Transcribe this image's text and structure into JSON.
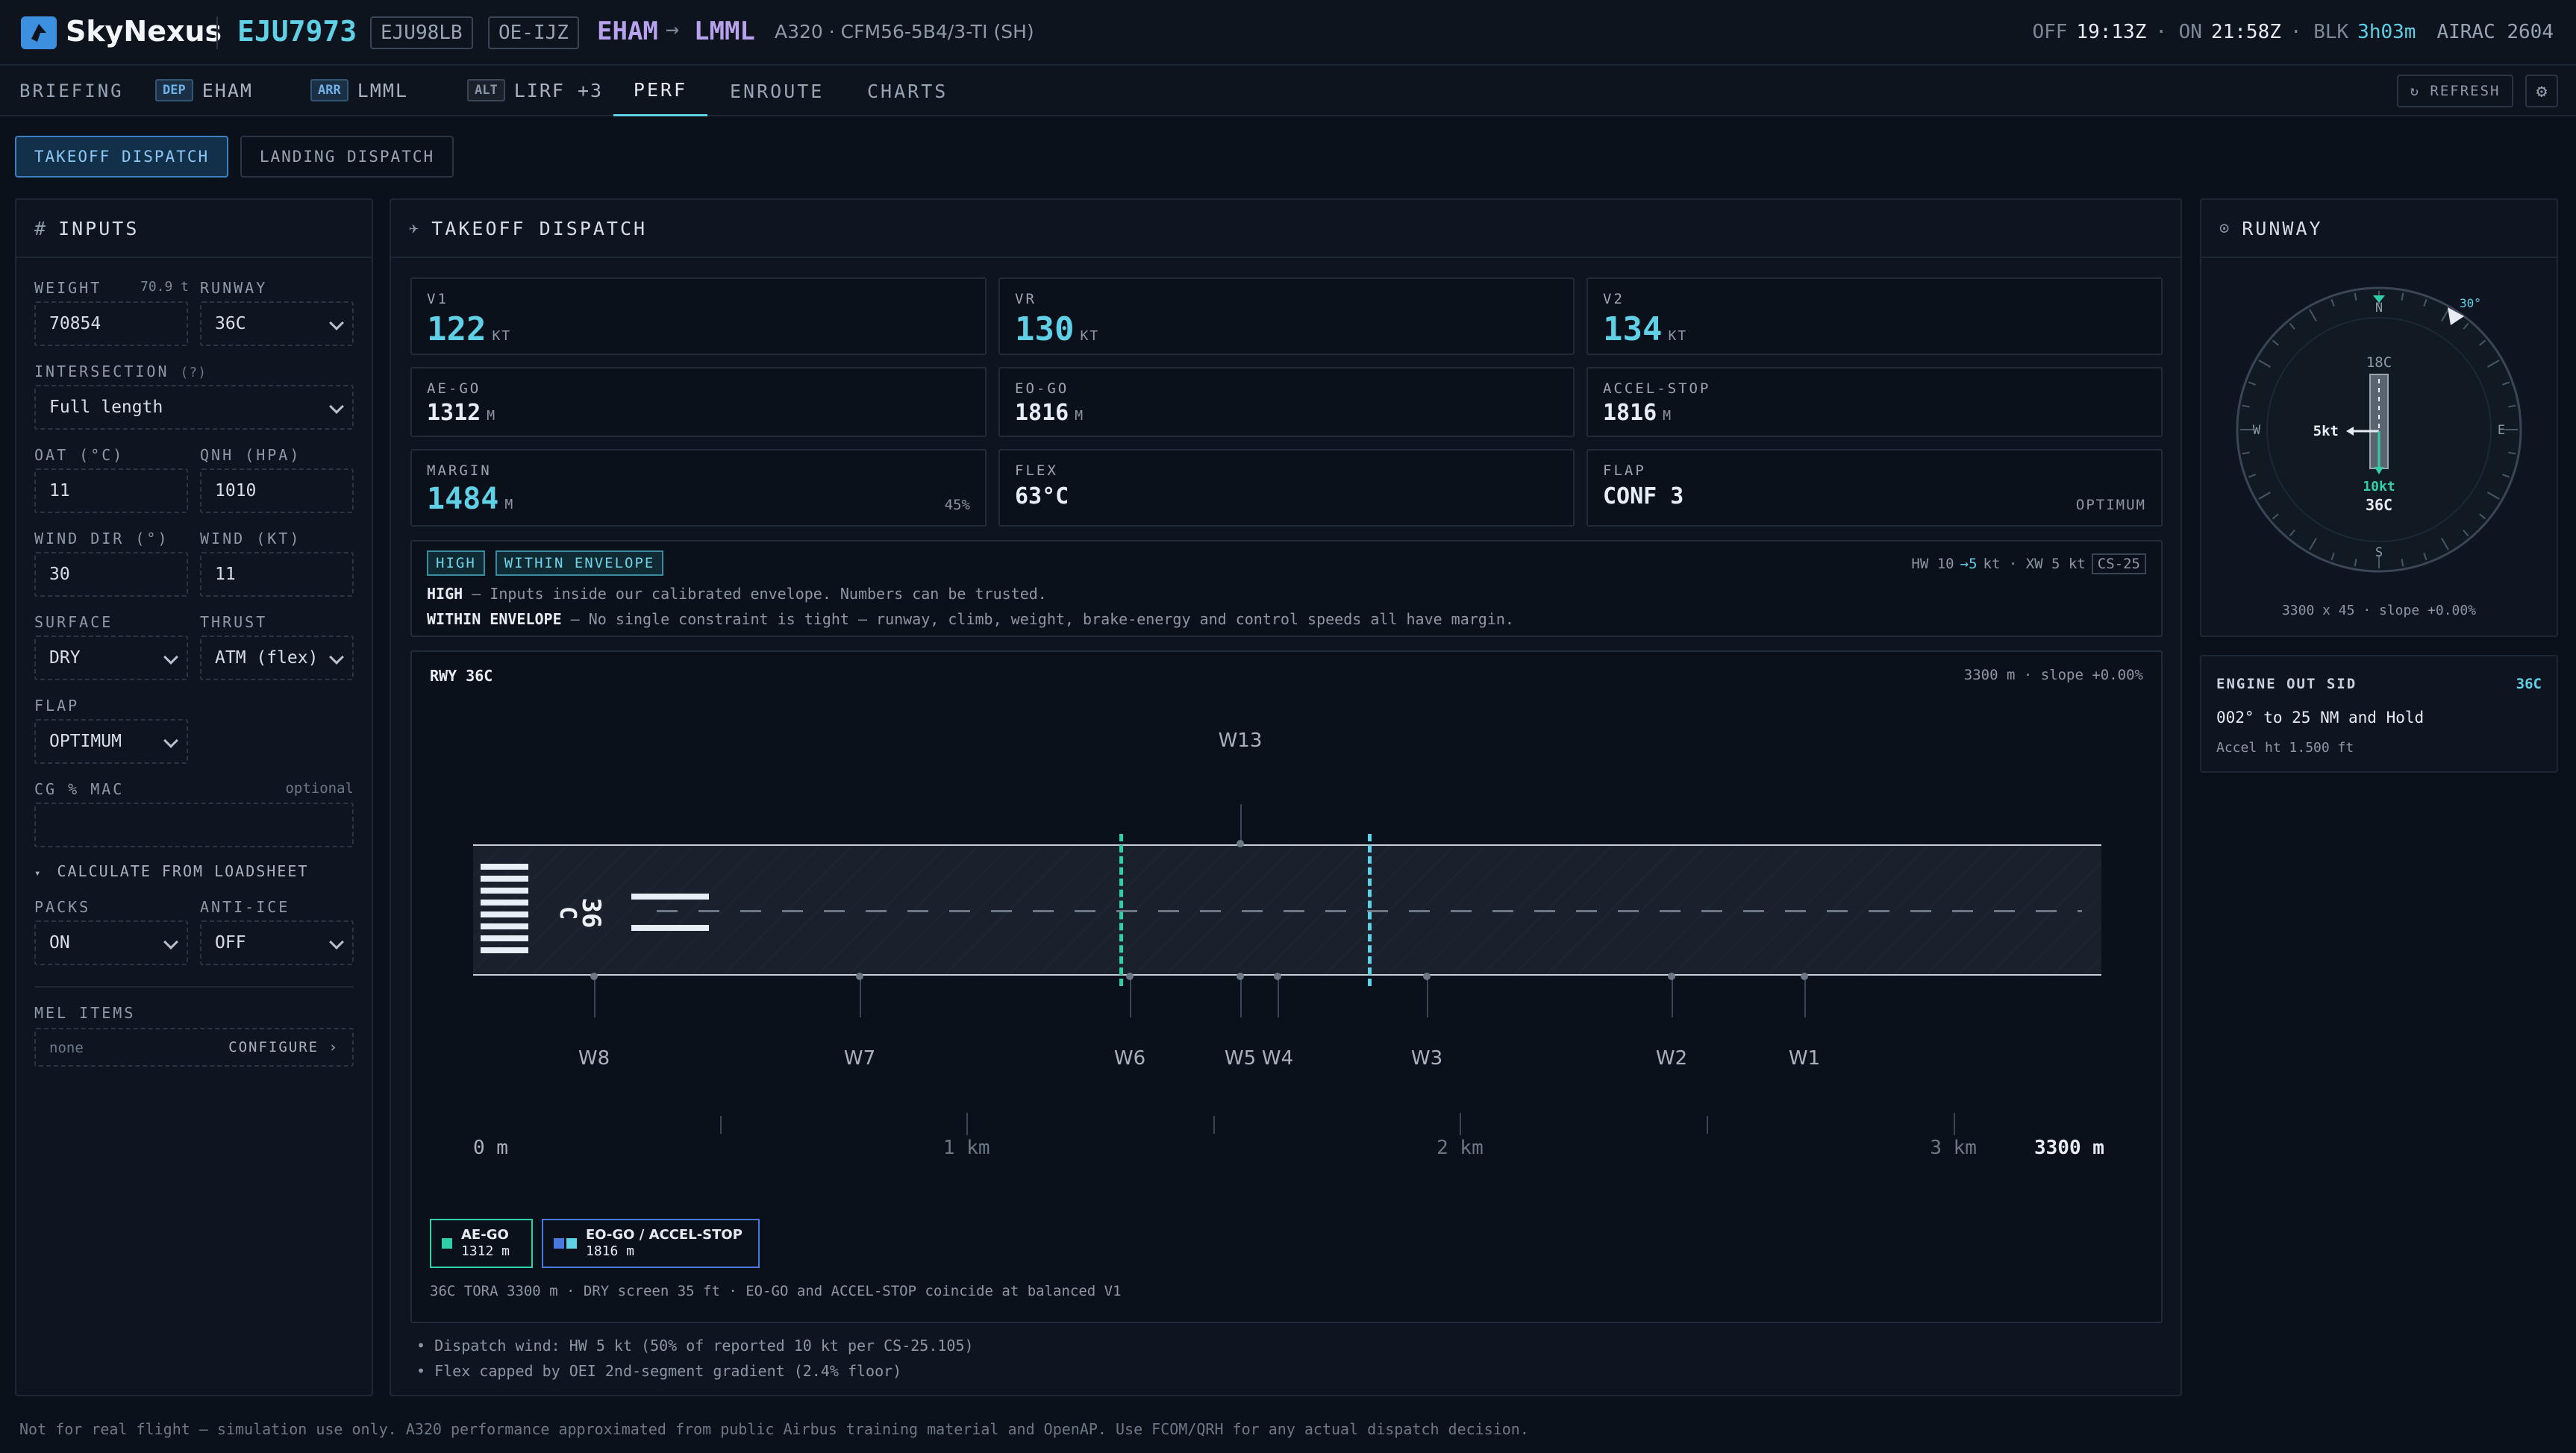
{
  "header": {
    "brand": "SkyNexus",
    "flight": "EJU7973",
    "callsign": "EJU98LB",
    "registration": "OE-IJZ",
    "origin": "EHAM",
    "destination": "LMML",
    "aircraft": "A320 · CFM56-5B4/3-TI (SH)",
    "off_label": "OFF",
    "off_time": "19:13Z",
    "on_label": "· ON",
    "on_time": "21:58Z",
    "blk_label": "· BLK",
    "blk_time": "3h03m",
    "airac": "AIRAC 2604"
  },
  "nav": {
    "briefing": "BRIEFING",
    "dep_tag": "DEP",
    "dep": "EHAM",
    "arr_tag": "ARR",
    "arr": "LMML",
    "alt_tag": "ALT",
    "alt": "LIRF +3",
    "perf": "PERF",
    "enroute": "ENROUTE",
    "charts": "CHARTS",
    "refresh": "↻ REFRESH"
  },
  "subtabs": {
    "takeoff": "TAKEOFF DISPATCH",
    "landing": "LANDING DISPATCH"
  },
  "inputs": {
    "title": "INPUTS",
    "weight_label": "WEIGHT",
    "weight_hint": "70.9 t",
    "weight": "70854",
    "runway_label": "RUNWAY",
    "runway": "36C",
    "intersection_label": "INTERSECTION",
    "intersection_help": "(?)",
    "intersection": "Full length",
    "oat_label": "OAT (°C)",
    "oat": "11",
    "qnh_label": "QNH (HPA)",
    "qnh": "1010",
    "wind_dir_label": "WIND DIR (°)",
    "wind_dir": "30",
    "wind_kt_label": "WIND (KT)",
    "wind_kt": "11",
    "surface_label": "SURFACE",
    "surface": "DRY",
    "thrust_label": "THRUST",
    "thrust": "ATM (flex)",
    "flap_label": "FLAP",
    "flap": "OPTIMUM",
    "cg_label": "CG % MAC",
    "cg_hint": "optional",
    "calc_loadsheet": "CALCULATE FROM LOADSHEET",
    "packs_label": "PACKS",
    "packs": "ON",
    "antiice_label": "ANTI-ICE",
    "antiice": "OFF",
    "mel_label": "MEL ITEMS",
    "mel_value": "none",
    "mel_configure": "CONFIGURE ›"
  },
  "dispatch": {
    "title": "TAKEOFF DISPATCH",
    "v1_label": "V1",
    "v1": "122",
    "v1_unit": "KT",
    "vr_label": "VR",
    "vr": "130",
    "vr_unit": "KT",
    "v2_label": "V2",
    "v2": "134",
    "v2_unit": "KT",
    "aego_label": "AE-GO",
    "aego": "1312",
    "aego_unit": "M",
    "eogo_label": "EO-GO",
    "eogo": "1816",
    "eogo_unit": "M",
    "accel_label": "ACCEL-STOP",
    "accel": "1816",
    "accel_unit": "M",
    "margin_label": "MARGIN",
    "margin": "1484",
    "margin_unit": "M",
    "margin_pct": "45%",
    "flex_label": "FLEX",
    "flex": "63°C",
    "flap_label": "FLAP",
    "flap": "CONF 3",
    "flap_note": "OPTIMUM",
    "badge_high": "HIGH",
    "badge_env": "WITHIN ENVELOPE",
    "wind_summary_a": "HW 10",
    "wind_summary_arrow": "→5",
    "wind_summary_b": "kt · XW 5 kt",
    "wind_rule": "CS-25",
    "high_key": "HIGH",
    "high_text": " — Inputs inside our calibrated envelope. Numbers can be trusted.",
    "env_key": "WITHIN ENVELOPE",
    "env_text": " — No single constraint is tight — runway, climb, weight, brake-energy and control speeds all have margin.",
    "rwy_title": "RWY 36C",
    "rwy_info": "3300 m · slope +0.00%",
    "rwy_number": "36",
    "rwy_letter": "C",
    "waypoints_top": [
      "W13"
    ],
    "waypoints_bottom": [
      "W8",
      "W7",
      "W6",
      "W5",
      "W4",
      "W3",
      "W2",
      "W1"
    ],
    "scale": [
      "0 m",
      "1 km",
      "2 km",
      "3 km",
      "3300 m"
    ],
    "legend_aego_label": "AE-GO",
    "legend_aego_value": "1312 m",
    "legend_eo_label": "EO-GO / ACCEL-STOP",
    "legend_eo_value": "1816 m",
    "footnote": "36C TORA 3300 m · DRY screen 35 ft · EO-GO and ACCEL-STOP coincide at balanced V1",
    "note1": "• Dispatch wind: HW 5 kt (50% of reported 10 kt per CS-25.105)",
    "note2": "• Flex capped by OEI 2nd-segment gradient (2.4% floor)"
  },
  "runway_panel": {
    "title": "RUNWAY",
    "n": "N",
    "e": "E",
    "s": "S",
    "w": "W",
    "wind_dir": "30°",
    "rwy_top": "18C",
    "rwy_bottom": "36C",
    "crosswind": "5kt",
    "headwind": "10kt",
    "info": "3300 x 45 · slope +0.00%",
    "sid_title": "ENGINE OUT SID",
    "sid_rwy": "36C",
    "sid_text": "002° to 25 NM and Hold",
    "sid_accel": "Accel ht 1.500 ft"
  },
  "footer": "Not for real flight — simulation use only. A320 performance approximated from public Airbus training material and OpenAP. Use FCOM/QRH for any actual dispatch decision.",
  "colors": {
    "accent": "#5fd0e6",
    "teal": "#2fd0a8",
    "blue": "#4a78e0",
    "bg": "#0b111a"
  }
}
